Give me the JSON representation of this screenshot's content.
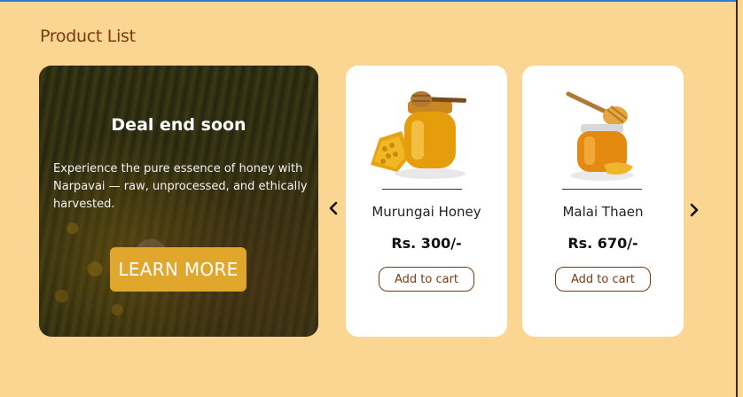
{
  "page": {
    "title": "Product List"
  },
  "deal": {
    "heading": "Deal end soon",
    "text": "Experience the pure essence of honey with Narpavai — raw, unprocessed, and ethically harvested.",
    "button_label": "LEARN MORE"
  },
  "carousel": {
    "prev_icon": "‹",
    "next_icon": "›"
  },
  "products": [
    {
      "name": "Murungai Honey",
      "price": "Rs. 300/-",
      "cart_label": "Add to cart",
      "image": "honey-jar-with-honeycomb"
    },
    {
      "name": "Malai Thaen",
      "price": "Rs. 670/-",
      "cart_label": "Add to cart",
      "image": "honey-jar-with-dipper"
    }
  ],
  "colors": {
    "background": "#fbd592",
    "accent": "#e0a72c",
    "brand_text": "#7a3a10"
  }
}
